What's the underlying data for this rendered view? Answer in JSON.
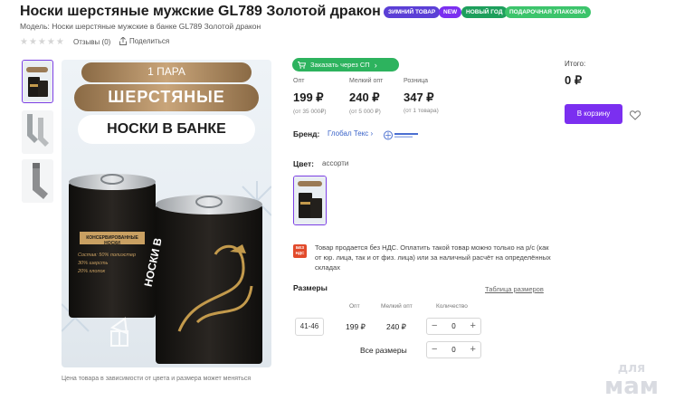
{
  "product": {
    "title": "Носки шерстяные мужские GL789 Золотой дракон",
    "badges": [
      {
        "label": "ЗИМНИЙ ТОВАР",
        "color": "#5b3fd6"
      },
      {
        "label": "NEW",
        "color": "#7b2ff0"
      },
      {
        "label": "НОВЫЙ ГОД",
        "color": "#1d9f5c"
      },
      {
        "label": "ПОДАРОЧНАЯ УПАКОВКА",
        "color": "#3cc46b"
      }
    ],
    "model": "Модель: Носки шерстяные мужские в банке GL789 Золотой дракон",
    "reviews_label": "Отзывы (0)",
    "share_label": "Поделиться"
  },
  "gallery": {
    "banner_top": "1 ПАРА",
    "banner_mid": "ШЕРСТЯНЫЕ",
    "banner_bottom": "НОСКИ В БАНКЕ",
    "can1_title": "КОНСЕРВИРОВАННЫЕ НОСКИ",
    "can1_lines": [
      "Состав: 50% полиэстер",
      "30% шерсть",
      "20% хлопок"
    ],
    "can2_title": "НОСКИ В",
    "note": "Цена товара в зависимости от цвета и размера может меняться"
  },
  "order": {
    "sp_label": "Заказать через СП",
    "prices": [
      {
        "label": "Опт",
        "value": "199 ₽",
        "sub": "(от 35 000₽)"
      },
      {
        "label": "Мелкий опт",
        "value": "240 ₽",
        "sub": "(от 5 000 ₽)"
      },
      {
        "label": "Розница",
        "value": "347 ₽",
        "sub": "(от 1 товара)"
      }
    ],
    "brand_label": "Бренд:",
    "brand_value": "Глобал Текс",
    "color_label": "Цвет:",
    "color_value": "ассорти",
    "vat_badge": "БЕЗ НДС",
    "vat_text": "Товар продается без НДС. Оплатить такой товар можно только на р/с (как от юр. лица, так и от физ. лица) или за наличный расчёт на определённых складах",
    "sizes_title": "Размеры",
    "size_table_link": "Таблица размеров",
    "headers": {
      "opt": "Опт",
      "small_opt": "Мелкий опт",
      "qty": "Количество"
    },
    "rows": [
      {
        "size": "41-46",
        "opt": "199 ₽",
        "small_opt": "240 ₽",
        "qty": "0"
      }
    ],
    "all_sizes_label": "Все размеры",
    "all_sizes_qty": "0"
  },
  "cart": {
    "total_label": "Итого:",
    "total_value": "0 ₽",
    "button_label": "В корзину"
  },
  "watermark": {
    "line1": "для",
    "line2": "мам"
  }
}
